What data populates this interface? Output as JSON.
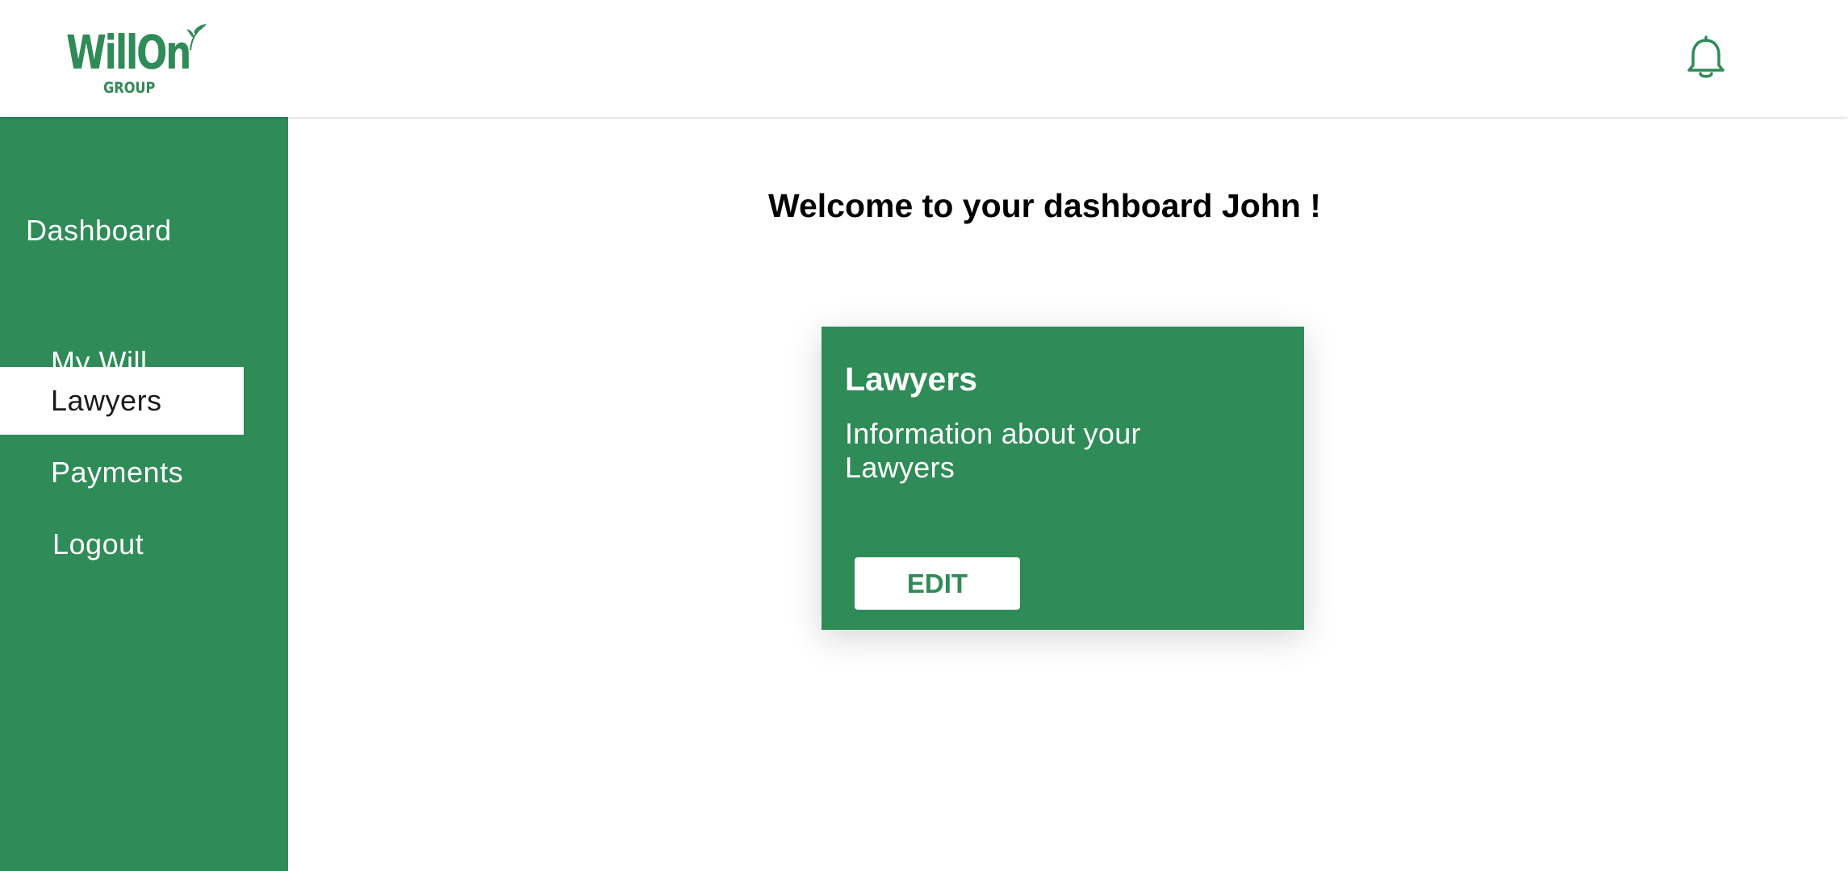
{
  "brand": {
    "name": "WillOn",
    "sub": "GROUP",
    "color": "#2f8b57"
  },
  "header": {
    "notification_icon": "bell-icon"
  },
  "sidebar": {
    "title": "Dashboard",
    "items": [
      {
        "label": "My Will",
        "active": false
      },
      {
        "label": "Lawyers",
        "active": true
      },
      {
        "label": "Payments",
        "active": false
      },
      {
        "label": "Logout",
        "active": false
      }
    ]
  },
  "main": {
    "welcome": "Welcome to your dashboard John !",
    "card": {
      "title": "Lawyers",
      "description": "Information about your Lawyers",
      "button_label": "EDIT"
    }
  }
}
